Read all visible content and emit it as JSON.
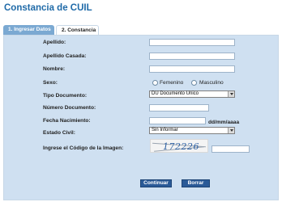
{
  "page_title": "Constancia de CUIL",
  "tabs": [
    {
      "label": "1. Ingresar Datos"
    },
    {
      "label": "2. Constancia"
    }
  ],
  "form": {
    "apellido_label": "Apellido:",
    "apellido_casada_label": "Apellido Casada:",
    "nombre_label": "Nombre:",
    "sexo_label": "Sexo:",
    "sexo_options": [
      "Femenino",
      "Masculino"
    ],
    "tipo_documento_label": "Tipo Documento:",
    "tipo_documento_value": "DU Documento Unico",
    "numero_documento_label": "Número Documento:",
    "fecha_nacimiento_label": "Fecha Nacimiento:",
    "fecha_format_hint": "dd/mm/aaaa",
    "estado_civil_label": "Estado Civil:",
    "estado_civil_value": "Sin Informar",
    "captcha_label": "Ingrese el Código de la Imagen:",
    "captcha_code": "172226"
  },
  "buttons": {
    "continuar": "Continuar",
    "borrar": "Borrar"
  },
  "icons": {
    "select_arrow": "chevron-down-icon"
  },
  "colors": {
    "title": "#1f6aa8",
    "panel_bg": "#cfe0f1",
    "active_tab": "#7ba9d2",
    "button": "#2a5a97"
  }
}
